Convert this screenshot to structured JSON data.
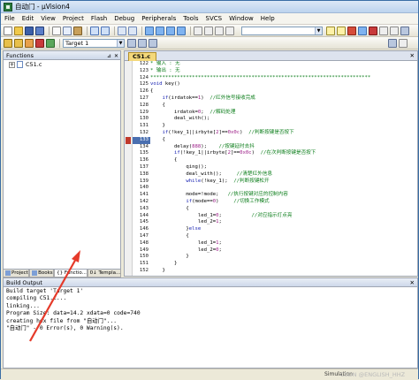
{
  "window": {
    "title": "自动门 - µVision4"
  },
  "menu": [
    "File",
    "Edit",
    "View",
    "Project",
    "Flash",
    "Debug",
    "Peripherals",
    "Tools",
    "SVCS",
    "Window",
    "Help"
  ],
  "toolbar": {
    "target": "Target 1"
  },
  "functions_panel": {
    "title": "Functions",
    "file": "C51.c",
    "tabs": [
      "Project",
      "Books",
      "{} Functio...",
      "0↓ Templa..."
    ]
  },
  "editor": {
    "tab": "C51.c",
    "current_line": 133,
    "breakpoint_line": 133,
    "lines": [
      {
        "n": 122,
        "segs": [
          {
            "t": "* 输入 : 无",
            "c": "cm"
          }
        ]
      },
      {
        "n": 123,
        "segs": [
          {
            "t": "* 输出 : 无",
            "c": "cm"
          }
        ]
      },
      {
        "n": 124,
        "segs": [
          {
            "t": "**************************************************************************",
            "c": "cm"
          }
        ]
      },
      {
        "n": 125,
        "segs": [
          {
            "t": "void",
            "c": "kw"
          },
          {
            "t": " key()"
          }
        ]
      },
      {
        "n": 126,
        "segs": [
          {
            "t": "{"
          }
        ]
      },
      {
        "n": 127,
        "segs": [
          {
            "t": "    "
          },
          {
            "t": "if",
            "c": "kw"
          },
          {
            "t": "(irdatok=="
          },
          {
            "t": "1",
            "c": "num"
          },
          {
            "t": ")  "
          },
          {
            "t": "//红外信号接收完成",
            "c": "cm"
          }
        ]
      },
      {
        "n": 128,
        "segs": [
          {
            "t": "    {"
          }
        ]
      },
      {
        "n": 129,
        "segs": [
          {
            "t": "        irdatok="
          },
          {
            "t": "0",
            "c": "num"
          },
          {
            "t": ";  "
          },
          {
            "t": "//解码处理",
            "c": "cm"
          }
        ]
      },
      {
        "n": 130,
        "segs": [
          {
            "t": "        deal_with();"
          }
        ]
      },
      {
        "n": 131,
        "segs": [
          {
            "t": "    }"
          }
        ]
      },
      {
        "n": 132,
        "segs": [
          {
            "t": "    "
          },
          {
            "t": "if",
            "c": "kw"
          },
          {
            "t": "(!key_1||irbyte["
          },
          {
            "t": "2",
            "c": "num"
          },
          {
            "t": "]=="
          },
          {
            "t": "0x0c",
            "c": "num"
          },
          {
            "t": ")  "
          },
          {
            "t": "//判断按键是否按下",
            "c": "cm"
          }
        ]
      },
      {
        "n": 133,
        "segs": [
          {
            "t": "    {"
          }
        ]
      },
      {
        "n": 134,
        "segs": [
          {
            "t": "        delay("
          },
          {
            "t": "888",
            "c": "num"
          },
          {
            "t": ");    "
          },
          {
            "t": "//按键延时去抖",
            "c": "cm"
          }
        ]
      },
      {
        "n": 135,
        "segs": [
          {
            "t": "        "
          },
          {
            "t": "if",
            "c": "kw"
          },
          {
            "t": "(!key_1||irbyte["
          },
          {
            "t": "2",
            "c": "num"
          },
          {
            "t": "]=="
          },
          {
            "t": "0x0c",
            "c": "num"
          },
          {
            "t": ")  "
          },
          {
            "t": "//在次判断按键是否按下",
            "c": "cm"
          }
        ]
      },
      {
        "n": 136,
        "segs": [
          {
            "t": "        {"
          }
        ]
      },
      {
        "n": 137,
        "segs": [
          {
            "t": "            qing();"
          }
        ]
      },
      {
        "n": 138,
        "segs": [
          {
            "t": "            deal_with();     "
          },
          {
            "t": "//清楚红外信息",
            "c": "cm"
          }
        ]
      },
      {
        "n": 139,
        "segs": [
          {
            "t": "            "
          },
          {
            "t": "while",
            "c": "kw"
          },
          {
            "t": "(!key_1);  "
          },
          {
            "t": "//判断按键松开",
            "c": "cm"
          }
        ]
      },
      {
        "n": 140,
        "segs": [
          {
            "t": ""
          }
        ]
      },
      {
        "n": 141,
        "segs": [
          {
            "t": "            mode=!mode;   "
          },
          {
            "t": "//执行按键对应的控制内容",
            "c": "cm"
          }
        ]
      },
      {
        "n": 142,
        "segs": [
          {
            "t": "            "
          },
          {
            "t": "if",
            "c": "kw"
          },
          {
            "t": "(mode=="
          },
          {
            "t": "0",
            "c": "num"
          },
          {
            "t": ")     "
          },
          {
            "t": "//切换工作模式",
            "c": "cm"
          }
        ]
      },
      {
        "n": 143,
        "segs": [
          {
            "t": "            {"
          }
        ]
      },
      {
        "n": 144,
        "segs": [
          {
            "t": "                led_1="
          },
          {
            "t": "0",
            "c": "num"
          },
          {
            "t": ";          "
          },
          {
            "t": "//对应指示灯点亮",
            "c": "cm"
          }
        ]
      },
      {
        "n": 145,
        "segs": [
          {
            "t": "                led_2="
          },
          {
            "t": "1",
            "c": "num"
          },
          {
            "t": ";"
          }
        ]
      },
      {
        "n": 146,
        "segs": [
          {
            "t": "            }"
          },
          {
            "t": "else",
            "c": "kw"
          }
        ]
      },
      {
        "n": 147,
        "segs": [
          {
            "t": "            {"
          }
        ]
      },
      {
        "n": 148,
        "segs": [
          {
            "t": "                led_1="
          },
          {
            "t": "1",
            "c": "num"
          },
          {
            "t": ";"
          }
        ]
      },
      {
        "n": 149,
        "segs": [
          {
            "t": "                led_2="
          },
          {
            "t": "0",
            "c": "num"
          },
          {
            "t": ";"
          }
        ]
      },
      {
        "n": 150,
        "segs": [
          {
            "t": "            }"
          }
        ]
      },
      {
        "n": 151,
        "segs": [
          {
            "t": "        }"
          }
        ]
      },
      {
        "n": 152,
        "segs": [
          {
            "t": "    }"
          }
        ]
      }
    ]
  },
  "build_output": {
    "title": "Build Output",
    "lines": [
      "Build target 'Target 1'",
      "compiling C51.c...",
      "linking...",
      "Program Size: data=14.2 xdata=0 code=740",
      "creating hex file from \"自动门\"...",
      "\"自动门\" - 0 Error(s), 0 Warning(s)."
    ]
  },
  "status": {
    "mode": "Simulation",
    "watermark": "CSDN @ENGLISH_HHZ"
  },
  "colors": {
    "annotation_arrow": "#e53a2a"
  }
}
